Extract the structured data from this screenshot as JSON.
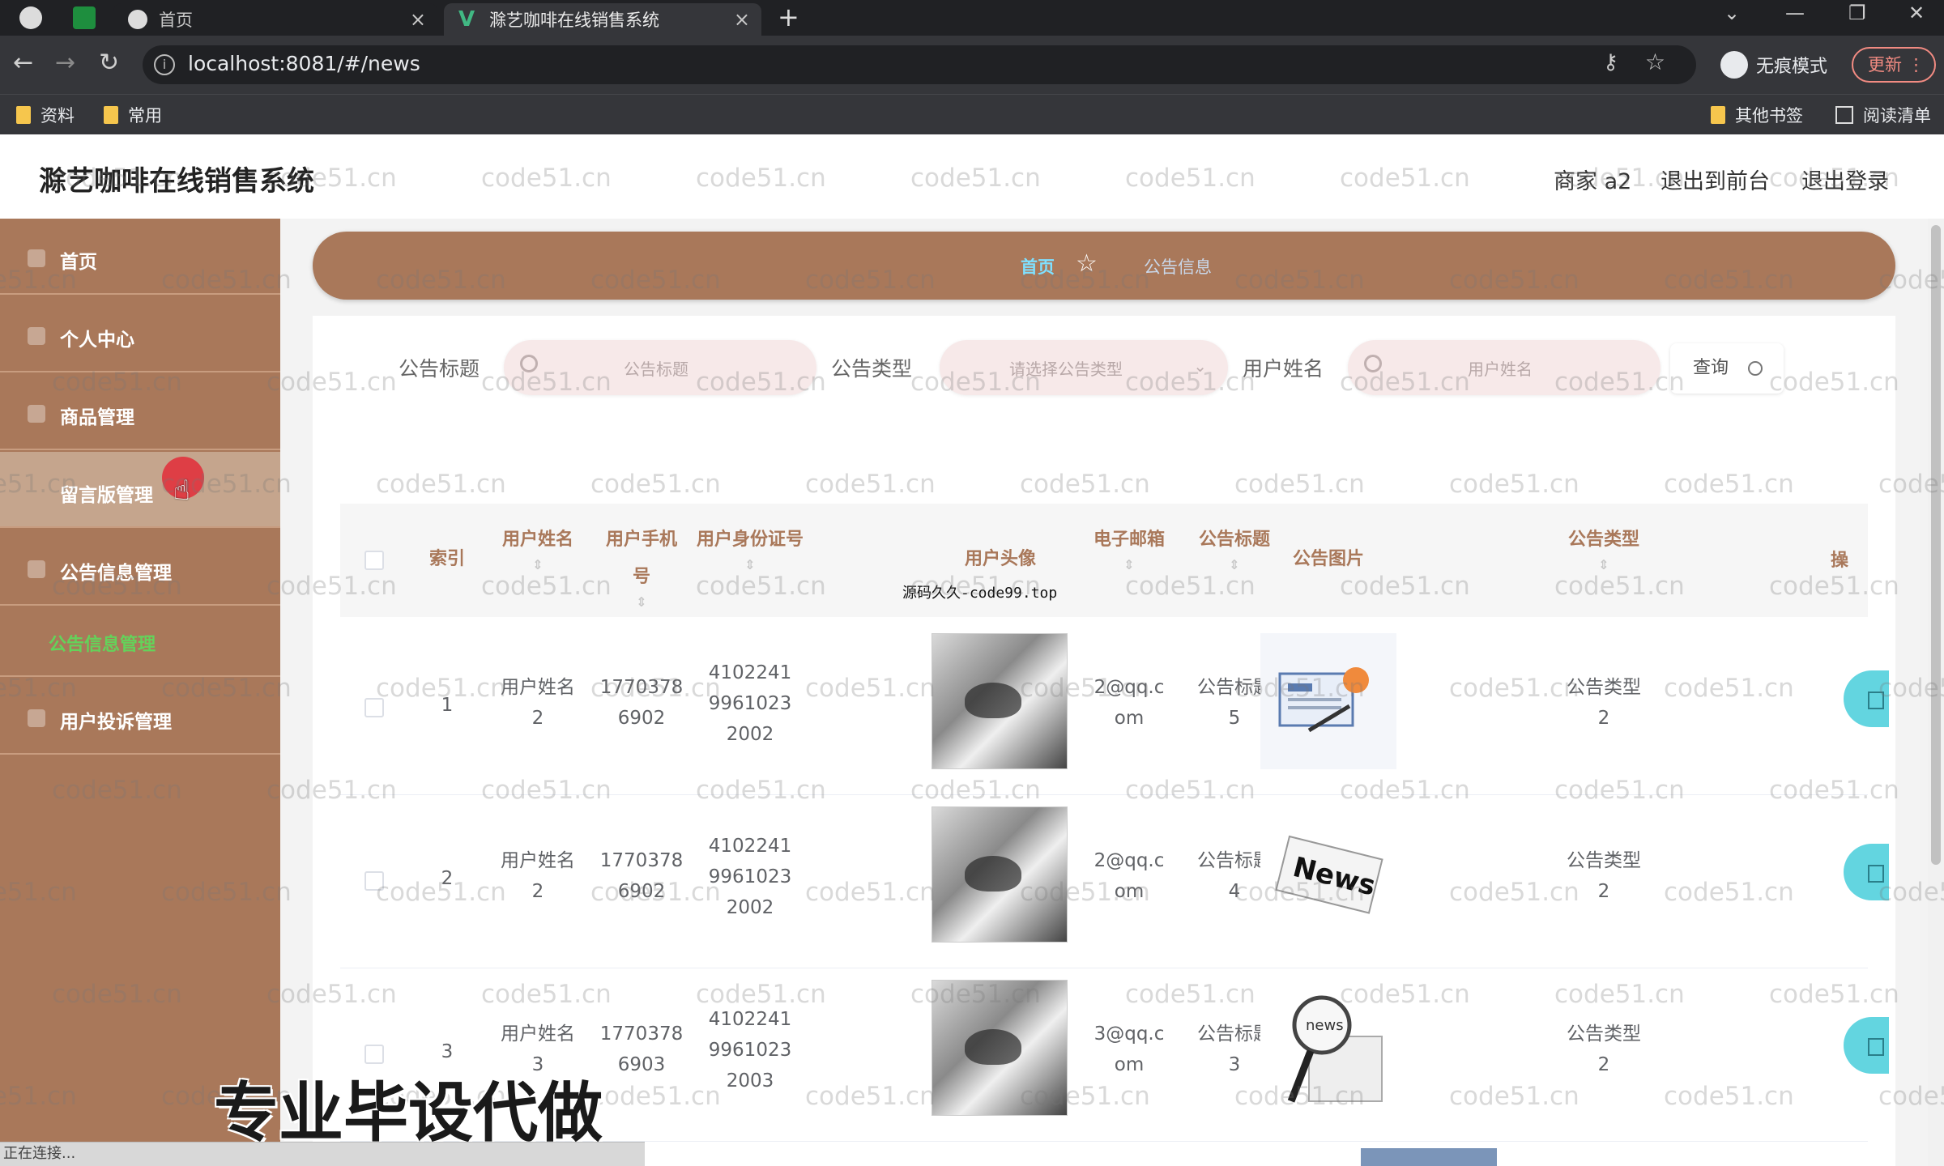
{
  "browser": {
    "tabs": [
      {
        "label": "首页"
      },
      {
        "label": "滁艺咖啡在线销售系统"
      }
    ],
    "url": "localhost:8081/#/news",
    "incognito_label": "无痕模式",
    "update_label": "更新",
    "bookmarks": [
      "资料",
      "常用"
    ],
    "bookmarks_right": [
      "其他书签",
      "阅读清单"
    ],
    "status_text": "正在连接..."
  },
  "header": {
    "title": "滁艺咖啡在线销售系统",
    "user": "商家 a2",
    "front_link": "退出到前台",
    "logout_link": "退出登录"
  },
  "sidebar": {
    "items": [
      {
        "label": "首页"
      },
      {
        "label": "个人中心"
      },
      {
        "label": "商品管理"
      },
      {
        "label": "留言版管理"
      },
      {
        "label": "公告信息管理"
      },
      {
        "label": "用户投诉管理"
      }
    ],
    "submenu_active": "公告信息管理"
  },
  "breadcrumb": {
    "home": "首页",
    "current": "公告信息"
  },
  "filters": {
    "title_label": "公告标题",
    "title_placeholder": "公告标题",
    "type_label": "公告类型",
    "type_placeholder": "请选择公告类型",
    "user_label": "用户姓名",
    "user_placeholder": "用户姓名",
    "query_label": "查询"
  },
  "table": {
    "columns": {
      "index": "索引",
      "user_name": "用户姓名",
      "phone": "用户手机号",
      "id_card": "用户身份证号",
      "avatar": "用户头像",
      "email": "电子邮箱",
      "notice_title": "公告标题",
      "notice_image": "公告图片",
      "notice_type": "公告类型",
      "cut": "操"
    },
    "rows": [
      {
        "index": "1",
        "user_name_1": "用户姓名",
        "user_name_2": "2",
        "phone_1": "1770378",
        "phone_2": "6902",
        "id_1": "4102241",
        "id_2": "9961023",
        "id_3": "2002",
        "email_1": "2@qq.c",
        "email_2": "om",
        "title_1": "公告标题",
        "title_2": "5",
        "type_1": "公告类型",
        "type_2": "2"
      },
      {
        "index": "2",
        "user_name_1": "用户姓名",
        "user_name_2": "2",
        "phone_1": "1770378",
        "phone_2": "6902",
        "id_1": "4102241",
        "id_2": "9961023",
        "id_3": "2002",
        "email_1": "2@qq.c",
        "email_2": "om",
        "title_1": "公告标题",
        "title_2": "4",
        "type_1": "公告类型",
        "type_2": "2"
      },
      {
        "index": "3",
        "user_name_1": "用户姓名",
        "user_name_2": "3",
        "phone_1": "1770378",
        "phone_2": "6903",
        "id_1": "4102241",
        "id_2": "9961023",
        "id_3": "2003",
        "email_1": "3@qq.c",
        "email_2": "om",
        "title_1": "公告标题",
        "title_2": "3",
        "type_1": "公告类型",
        "type_2": "2"
      }
    ]
  },
  "overlay": {
    "watermark": "code51.cn",
    "site_mark": "源码久久-code99.top",
    "banner": "专业毕设代做"
  },
  "colors": {
    "accent": "#a9785a",
    "active_sub": "#64d25a",
    "breadcrumb_home": "#7fe0ff"
  }
}
